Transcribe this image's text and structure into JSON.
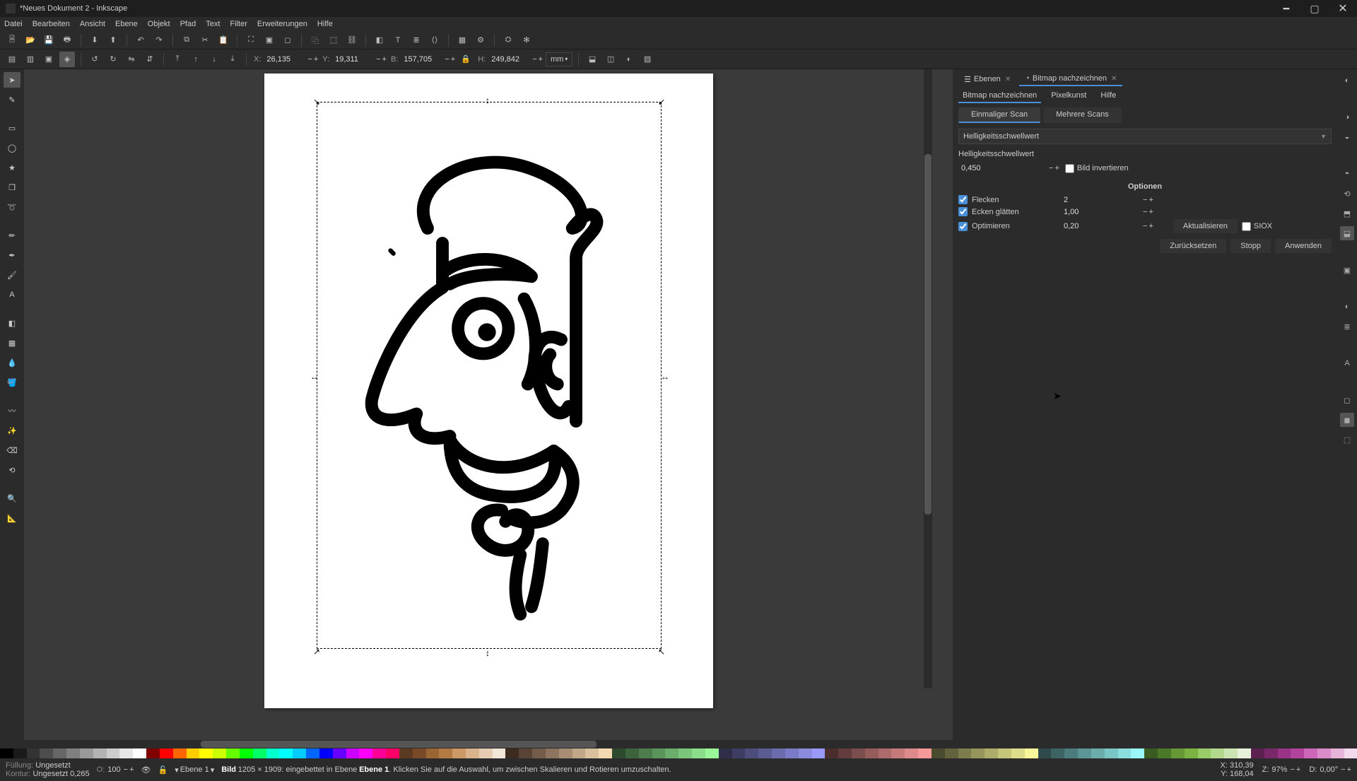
{
  "window": {
    "title": "*Neues Dokument 2 - Inkscape"
  },
  "menu": [
    "Datei",
    "Bearbeiten",
    "Ansicht",
    "Ebene",
    "Objekt",
    "Pfad",
    "Text",
    "Filter",
    "Erweiterungen",
    "Hilfe"
  ],
  "coords": {
    "x_label": "X:",
    "x": "26,135",
    "y_label": "Y:",
    "y": "19,311",
    "w_label": "B:",
    "w": "157,705",
    "h_label": "H:",
    "h": "249,842",
    "unit": "mm"
  },
  "panel": {
    "tab_layers": "Ebenen",
    "tab_trace": "Bitmap nachzeichnen",
    "subtab_trace": "Bitmap nachzeichnen",
    "subtab_pixel": "Pixelkunst",
    "subtab_help": "Hilfe",
    "mode_single": "Einmaliger Scan",
    "mode_multi": "Mehrere Scans",
    "method": "Helligkeitsschwellwert",
    "threshold_label": "Helligkeitsschwellwert",
    "threshold_val": "0,450",
    "invert": "Bild invertieren",
    "options_hdr": "Optionen",
    "opt_speckles": "Flecken",
    "opt_speckles_v": "2",
    "opt_smooth": "Ecken glätten",
    "opt_smooth_v": "1,00",
    "opt_optimize": "Optimieren",
    "opt_optimize_v": "0,20",
    "btn_update": "Aktualisieren",
    "siox": "SIOX",
    "btn_reset": "Zurücksetzen",
    "btn_stop": "Stopp",
    "btn_apply": "Anwenden"
  },
  "status": {
    "fill_lbl": "Füllung:",
    "fill_val": "Ungesetzt",
    "stroke_lbl": "Kontur:",
    "stroke_val": "Ungesetzt",
    "stroke_w": "0,265",
    "opacity_lbl": "O:",
    "opacity_val": "100",
    "layer": "Ebene 1",
    "msg_pre": "Bild",
    "msg_dim": "1205 × 1909: eingebettet in Ebene",
    "msg_layer": "Ebene 1",
    "msg_post": ". Klicken Sie auf die Auswahl, um zwischen Skalieren und Rotieren umzuschalten.",
    "xy_x": "310,39",
    "xy_y": "168,04",
    "zoom_lbl": "Z:",
    "zoom": "97%",
    "rot_lbl": "D:",
    "rot": "0,00°",
    "x_lbl": "X:",
    "y_lbl": "Y:"
  },
  "palette_colors": [
    "#000000",
    "#1a1a1a",
    "#333333",
    "#4d4d4d",
    "#666666",
    "#808080",
    "#999999",
    "#b3b3b3",
    "#cccccc",
    "#e6e6e6",
    "#ffffff",
    "#800000",
    "#ff0000",
    "#ff6600",
    "#ffcc00",
    "#ffff00",
    "#ccff00",
    "#66ff00",
    "#00ff00",
    "#00ff66",
    "#00ffcc",
    "#00ffff",
    "#00ccff",
    "#0066ff",
    "#0000ff",
    "#6600ff",
    "#cc00ff",
    "#ff00ff",
    "#ff0099",
    "#ff0066",
    "#5c3a21",
    "#7a4a28",
    "#996633",
    "#b37a42",
    "#cc9966",
    "#d9b38c",
    "#e6ccb3",
    "#f2e6d9",
    "#3d2b1f",
    "#594334",
    "#735c49",
    "#8c745e",
    "#a68d73",
    "#bfa788",
    "#d9c09d",
    "#f2d9b2",
    "#2e4a2e",
    "#3d633d",
    "#4d7c4d",
    "#5c955c",
    "#6bad6b",
    "#7ac67a",
    "#8ade8a",
    "#99f799",
    "#2e2e4a",
    "#3d3d63",
    "#4d4d7c",
    "#5c5c95",
    "#6b6bad",
    "#7a7ac6",
    "#8a8ade",
    "#9999f7",
    "#4a2e2e",
    "#633d3d",
    "#7c4d4d",
    "#955c5c",
    "#ad6b6b",
    "#c67a7a",
    "#de8a8a",
    "#f79999",
    "#4a4a2e",
    "#63633d",
    "#7c7c4d",
    "#95955c",
    "#adad6b",
    "#c6c67a",
    "#dede8a",
    "#f7f799",
    "#2e4a4a",
    "#3d6363",
    "#4d7c7c",
    "#5c9595",
    "#6badad",
    "#7ac6c6",
    "#8adede",
    "#99f7f7",
    "#3a5c21",
    "#4a7a28",
    "#669933",
    "#7ab342",
    "#99cc66",
    "#b3d98c",
    "#cce6b3",
    "#e6f2d9",
    "#5c2150",
    "#7a286a",
    "#993385",
    "#b3429f",
    "#cc66b8",
    "#d98cc9",
    "#e6b3da",
    "#f2d9ec"
  ]
}
